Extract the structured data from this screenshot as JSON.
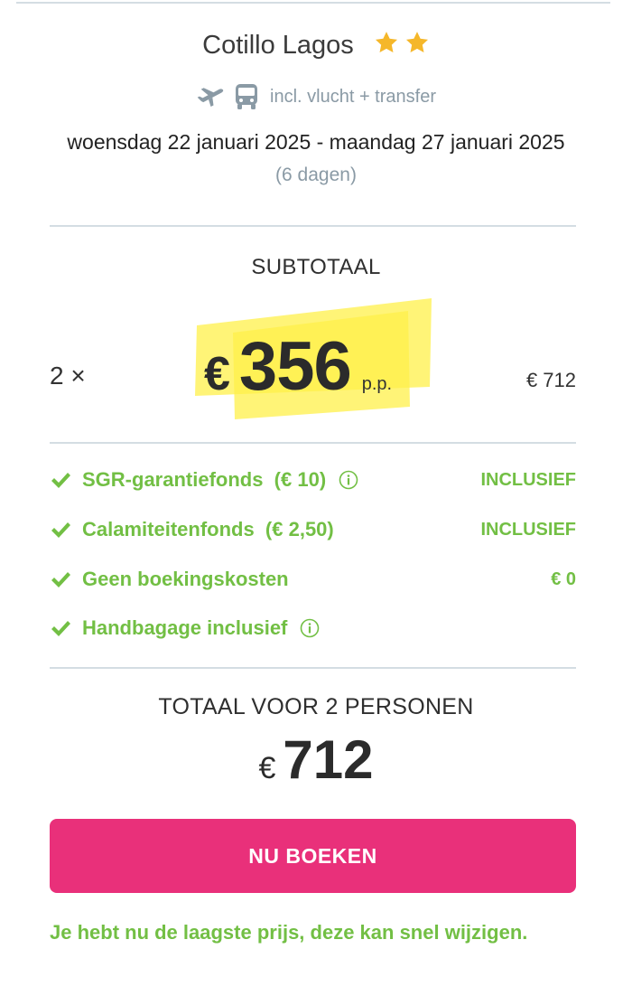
{
  "hotel": {
    "name": "Cotillo Lagos",
    "stars": 2,
    "star_color": "#f5b72a"
  },
  "transport": {
    "icons": [
      "plane-icon",
      "bus-icon"
    ],
    "label": "incl. vlucht + transfer"
  },
  "trip": {
    "dates": "woensdag 22 januari 2025 - maandag 27 januari 2025",
    "duration": "(6 dagen)"
  },
  "subtotal": {
    "label": "SUBTOTAAL",
    "quantity": "2 ×",
    "currency": "€",
    "price": "356",
    "per_person": "p.p.",
    "line_total": "€ 712",
    "highlight_color": "#fff04a"
  },
  "fees": [
    {
      "label": "SGR-garantiefonds  (€ 10)",
      "info": true,
      "value": "INCLUSIEF"
    },
    {
      "label": "Calamiteitenfonds  (€ 2,50)",
      "info": false,
      "value": "INCLUSIEF"
    },
    {
      "label": "Geen boekingskosten",
      "info": false,
      "value": "€ 0"
    },
    {
      "label": "Handbagage inclusief",
      "info": true,
      "value": ""
    }
  ],
  "total": {
    "label": "TOTAAL VOOR 2 PERSONEN",
    "currency": "€",
    "value": "712"
  },
  "book_button": {
    "label": "NU BOEKEN",
    "color": "#e9307a"
  },
  "notice": "Je hebt nu de laagste prijs, deze kan snel wijzigen.",
  "colors": {
    "accent_green": "#72bf44",
    "divider": "#d4dde3",
    "muted": "#8a9aa5"
  }
}
